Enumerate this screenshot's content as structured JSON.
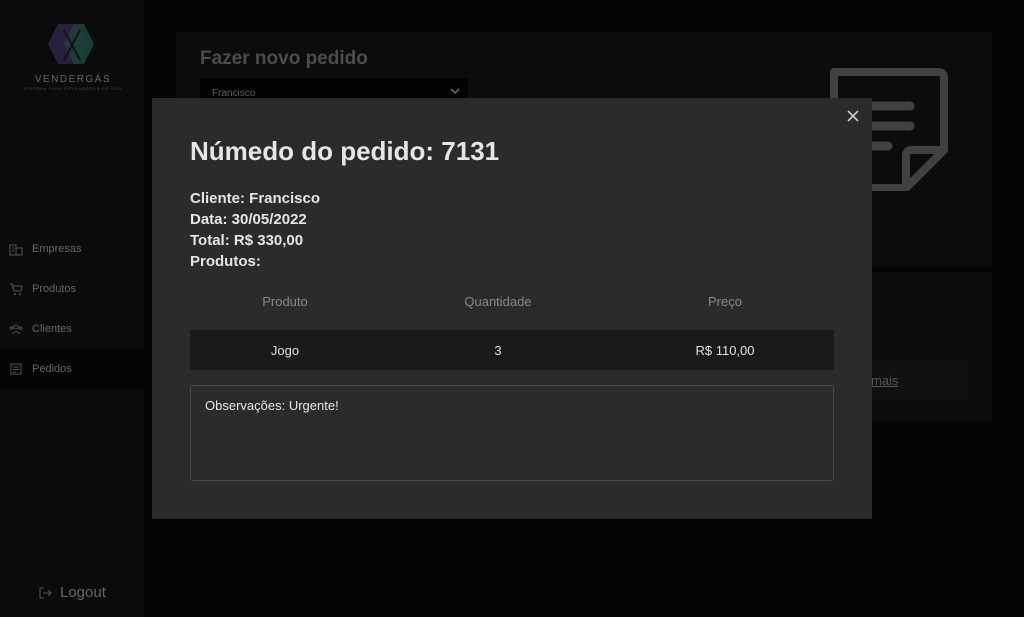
{
  "brand": {
    "name": "VENDERGÁS",
    "tagline": "SISTEMA PARA REVENDEDOR DE GÁS",
    "colors": {
      "purple": "#4b3a72",
      "teal": "#2f7a6a"
    }
  },
  "sidebar": {
    "items": [
      {
        "label": "Empresas",
        "icon": "building-icon",
        "active": false
      },
      {
        "label": "Produtos",
        "icon": "cart-icon",
        "active": false
      },
      {
        "label": "Clientes",
        "icon": "users-icon",
        "active": false
      },
      {
        "label": "Pedidos",
        "icon": "receipt-icon",
        "active": true
      }
    ],
    "logout_label": "Logout"
  },
  "background": {
    "title": "Fazer novo pedido",
    "client_select_value": "Francisco",
    "more_link": "mais"
  },
  "modal": {
    "title": "Númedo do pedido: 7131",
    "cliente": "Cliente: Francisco",
    "data": "Data: 30/05/2022",
    "total": "Total: R$ 330,00",
    "produtos": "Produtos:",
    "table": {
      "headers": [
        "Produto",
        "Quantidade",
        "Preço"
      ],
      "rows": [
        [
          "Jogo",
          "3",
          "R$ 110,00"
        ]
      ]
    },
    "observacoes": "Observações: Urgente!"
  }
}
